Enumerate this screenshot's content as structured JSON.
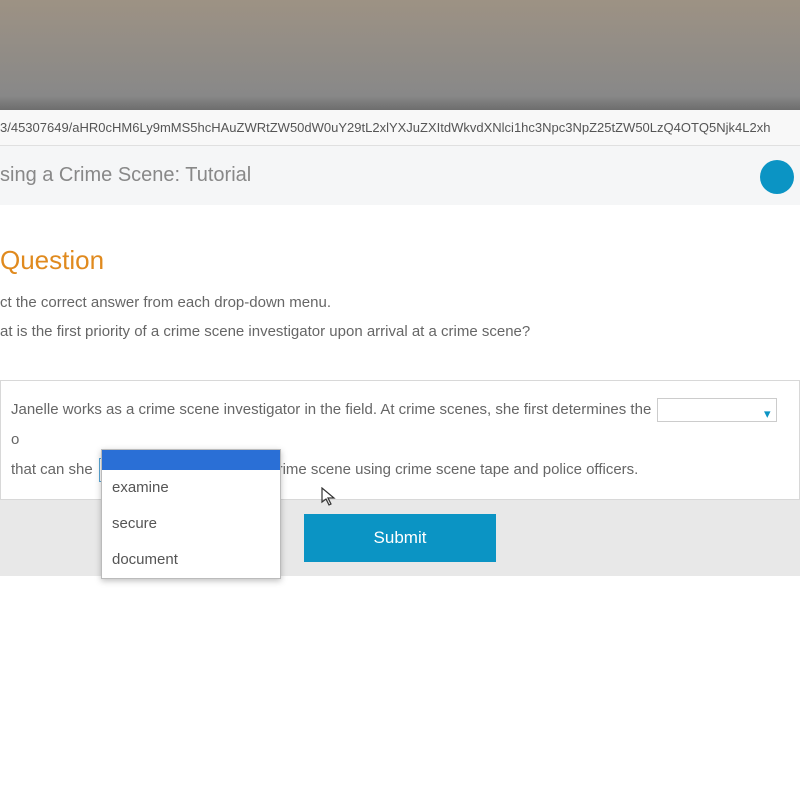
{
  "url": "3/45307649/aHR0cHM6Ly9mMS5hcHAuZWRtZW50dW0uY29tL2xlYXJuZXItdWkvdXNlci1hc3Npc3NpZ25tZW50LzQ4OTQ5Njk4L2xh",
  "header": {
    "title": "sing a Crime Scene: Tutorial"
  },
  "question": {
    "heading": "Question",
    "instruction": "ct the correct answer from each drop-down menu.",
    "prompt": "at is the first priority of a crime scene investigator upon arrival at a crime scene?",
    "text_part1": "Janelle works as a crime scene investigator in the field. At crime scenes, she first determines the",
    "text_part2": "o",
    "text_part3": "that can she",
    "text_part4": "the crime scene using crime scene tape and police officers."
  },
  "dropdown": {
    "options": [
      "examine",
      "secure",
      "document"
    ]
  },
  "submit": {
    "label": "Submit"
  }
}
